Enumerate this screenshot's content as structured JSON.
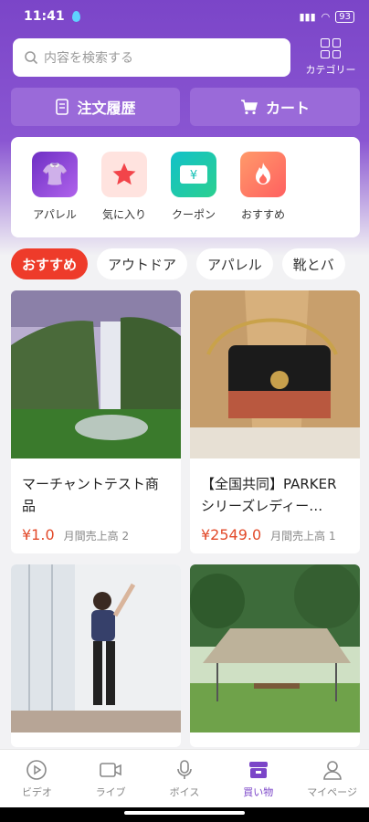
{
  "status": {
    "time": "11:41",
    "battery": "93"
  },
  "search": {
    "placeholder": "内容を検索する"
  },
  "category": {
    "label": "カテゴリー"
  },
  "buttons": {
    "orders": "注文履歴",
    "cart": "カート"
  },
  "quick_links": [
    {
      "label": "アパレル",
      "icon": "clothing-icon",
      "color": "#8a3fd6"
    },
    {
      "label": "気に入り",
      "icon": "star-icon",
      "color": "#ffe0dc"
    },
    {
      "label": "クーポン",
      "icon": "coupon-icon",
      "color": "#1ec8b0"
    },
    {
      "label": "おすすめ",
      "icon": "flame-icon",
      "color": "#ff7e64"
    }
  ],
  "chips": [
    "おすすめ",
    "アウトドア",
    "アパレル",
    "靴とバ"
  ],
  "products": [
    {
      "title": "マーチャントテスト商品",
      "price": "¥1.0",
      "sold": "月間売上高 2"
    },
    {
      "title": "【全国共同】PARKER シリーズレディー…",
      "price": "¥2549.0",
      "sold": "月間売上高 1"
    },
    {
      "title": "",
      "price": "",
      "sold": ""
    },
    {
      "title": "",
      "price": "",
      "sold": ""
    }
  ],
  "nav": [
    {
      "label": "ビデオ",
      "icon": "play-icon"
    },
    {
      "label": "ライブ",
      "icon": "camera-icon"
    },
    {
      "label": "ボイス",
      "icon": "mic-icon"
    },
    {
      "label": "買い物",
      "icon": "shop-icon"
    },
    {
      "label": "マイページ",
      "icon": "user-icon"
    }
  ]
}
